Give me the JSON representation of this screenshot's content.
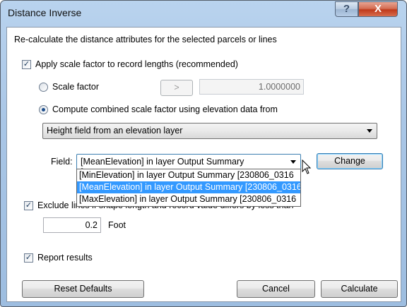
{
  "window": {
    "title": "Distance Inverse",
    "help_glyph": "?",
    "close_glyph": "X"
  },
  "description": "Re-calculate the distance attributes for the selected parcels or lines",
  "apply_scale": {
    "checked": true,
    "label": "Apply scale factor to record lengths (recommended)"
  },
  "scale_factor": {
    "label": "Scale factor",
    "selected": false,
    "button_label": ">",
    "value": "1.0000000"
  },
  "combined": {
    "label": "Compute combined scale factor using elevation data from",
    "selected": true
  },
  "elevation_source": {
    "value": "Height field from an elevation layer"
  },
  "field": {
    "label": "Field:",
    "value": "[MeanElevation] in layer Output Summary [230806_0316",
    "options": [
      "[MinElevation] in layer Output Summary [230806_0316",
      "[MeanElevation] in layer Output Summary [230806_0316",
      "[MaxElevation] in layer Output Summary [230806_0316"
    ],
    "selected_index": 1,
    "change_button": "Change"
  },
  "exclude": {
    "checked": true,
    "label": "Exclude lines if shape length and record value differs by less than",
    "value": "0.2",
    "unit": "Foot"
  },
  "report": {
    "checked": true,
    "label": "Report results"
  },
  "buttons": {
    "reset": "Reset Defaults",
    "cancel": "Cancel",
    "calculate": "Calculate"
  },
  "colors": {
    "selection": "#3399ff",
    "radio_dot": "#1d4e8c",
    "title_gradient": "#b9d3ee"
  },
  "icons": {
    "check": "✓",
    "close": "close-icon",
    "help": "help-icon",
    "cursor": "mouse-pointer-icon"
  }
}
